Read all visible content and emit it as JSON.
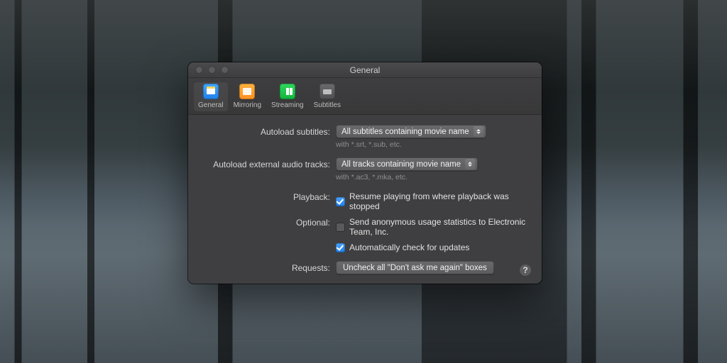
{
  "window": {
    "title": "General"
  },
  "tabs": [
    {
      "label": "General",
      "icon": "general-icon",
      "selected": true
    },
    {
      "label": "Mirroring",
      "icon": "mirroring-icon",
      "selected": false
    },
    {
      "label": "Streaming",
      "icon": "streaming-icon",
      "selected": false
    },
    {
      "label": "Subtitles",
      "icon": "subtitles-icon",
      "selected": false
    }
  ],
  "labels": {
    "autoload_subtitles": "Autoload subtitles:",
    "autoload_audio": "Autoload external audio tracks:",
    "playback": "Playback:",
    "optional": "Optional:",
    "requests": "Requests:"
  },
  "values": {
    "subtitles_popup": "All subtitles containing movie name",
    "subtitles_hint": "with *.srt, *.sub, etc.",
    "audio_popup": "All tracks containing movie name",
    "audio_hint": "with *.ac3, *.mka, etc."
  },
  "checks": {
    "resume": {
      "label": "Resume playing from where playback was stopped",
      "checked": true
    },
    "stats": {
      "label": "Send anonymous usage statistics to Electronic Team, Inc.",
      "checked": false
    },
    "updates": {
      "label": "Automatically check for updates",
      "checked": true
    }
  },
  "buttons": {
    "requests": "Uncheck all \"Don't ask me again\" boxes"
  }
}
